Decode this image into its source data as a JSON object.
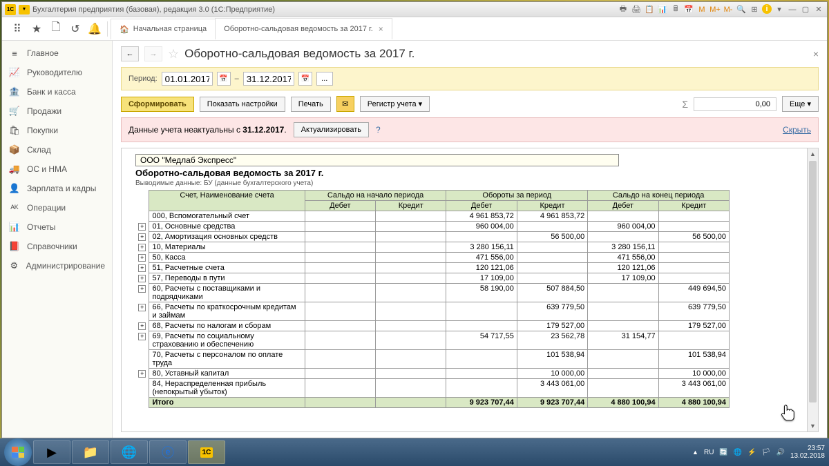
{
  "window_title": "Бухгалтерия предприятия (базовая), редакция 3.0  (1С:Предприятие)",
  "logo_text": "1С",
  "tabs": {
    "home": "Начальная страница",
    "report": "Оборотно-сальдовая ведомость за 2017 г."
  },
  "sidebar": [
    {
      "icon": "≡",
      "label": "Главное"
    },
    {
      "icon": "📈",
      "label": "Руководителю"
    },
    {
      "icon": "🏦",
      "label": "Банк и касса"
    },
    {
      "icon": "🛒",
      "label": "Продажи"
    },
    {
      "icon": "🛍",
      "label": "Покупки"
    },
    {
      "icon": "📦",
      "label": "Склад"
    },
    {
      "icon": "🚚",
      "label": "ОС и НМА"
    },
    {
      "icon": "👤",
      "label": "Зарплата и кадры"
    },
    {
      "icon": "ᴬᴷ",
      "label": "Операции"
    },
    {
      "icon": "📊",
      "label": "Отчеты"
    },
    {
      "icon": "📕",
      "label": "Справочники"
    },
    {
      "icon": "⚙",
      "label": "Администрирование"
    }
  ],
  "page": {
    "title": "Оборотно-сальдовая ведомость за 2017 г.",
    "period_label": "Период:",
    "date_from": "01.01.2017",
    "date_to": "31.12.2017",
    "form_btn": "Сформировать",
    "settings_btn": "Показать настройки",
    "print_btn": "Печать",
    "register_btn": "Регистр учета",
    "more_btn": "Еще",
    "sum_value": "0,00",
    "alert_text_a": "Данные учета неактуальны с ",
    "alert_date": "31.12.2017",
    "alert_btn": "Актуализировать",
    "alert_hide": "Скрыть"
  },
  "report": {
    "org": "ООО \"Медлаб Экспресс\"",
    "title": "Оборотно-сальдовая ведомость за 2017 г.",
    "subtitle": "Выводимые данные:  БУ (данные бухгалтерского учета)",
    "headers": {
      "acct": "Счет, Наименование счета",
      "g1": "Сальдо на начало периода",
      "g2": "Обороты за период",
      "g3": "Сальдо на конец периода",
      "debit": "Дебет",
      "credit": "Кредит"
    },
    "rows": [
      {
        "exp": false,
        "acct": "000, Вспомогательный счет",
        "d1": "",
        "c1": "",
        "d2": "4 961 853,72",
        "c2": "4 961 853,72",
        "d3": "",
        "c3": ""
      },
      {
        "exp": true,
        "acct": "01, Основные средства",
        "d1": "",
        "c1": "",
        "d2": "960 004,00",
        "c2": "",
        "d3": "960 004,00",
        "c3": ""
      },
      {
        "exp": true,
        "acct": "02, Амортизация основных средств",
        "d1": "",
        "c1": "",
        "d2": "",
        "c2": "56 500,00",
        "d3": "",
        "c3": "56 500,00"
      },
      {
        "exp": true,
        "acct": "10, Материалы",
        "d1": "",
        "c1": "",
        "d2": "3 280 156,11",
        "c2": "",
        "d3": "3 280 156,11",
        "c3": ""
      },
      {
        "exp": true,
        "acct": "50, Касса",
        "d1": "",
        "c1": "",
        "d2": "471 556,00",
        "c2": "",
        "d3": "471 556,00",
        "c3": ""
      },
      {
        "exp": true,
        "acct": "51, Расчетные счета",
        "d1": "",
        "c1": "",
        "d2": "120 121,06",
        "c2": "",
        "d3": "120 121,06",
        "c3": ""
      },
      {
        "exp": true,
        "acct": "57, Переводы в пути",
        "d1": "",
        "c1": "",
        "d2": "17 109,00",
        "c2": "",
        "d3": "17 109,00",
        "c3": ""
      },
      {
        "exp": true,
        "acct": "60, Расчеты с поставщиками и подрядчиками",
        "d1": "",
        "c1": "",
        "d2": "58 190,00",
        "c2": "507 884,50",
        "d3": "",
        "c3": "449 694,50"
      },
      {
        "exp": true,
        "acct": "66, Расчеты по краткосрочным кредитам и займам",
        "d1": "",
        "c1": "",
        "d2": "",
        "c2": "639 779,50",
        "d3": "",
        "c3": "639 779,50"
      },
      {
        "exp": true,
        "acct": "68, Расчеты по налогам и сборам",
        "d1": "",
        "c1": "",
        "d2": "",
        "c2": "179 527,00",
        "d3": "",
        "c3": "179 527,00"
      },
      {
        "exp": true,
        "acct": "69, Расчеты по социальному страхованию и обеспечению",
        "d1": "",
        "c1": "",
        "d2": "54 717,55",
        "c2": "23 562,78",
        "d3": "31 154,77",
        "c3": ""
      },
      {
        "exp": false,
        "acct": "70, Расчеты с персоналом по оплате труда",
        "d1": "",
        "c1": "",
        "d2": "",
        "c2": "101 538,94",
        "d3": "",
        "c3": "101 538,94"
      },
      {
        "exp": true,
        "acct": "80, Уставный капитал",
        "d1": "",
        "c1": "",
        "d2": "",
        "c2": "10 000,00",
        "d3": "",
        "c3": "10 000,00"
      },
      {
        "exp": false,
        "acct": "84, Нераспределенная прибыль (непокрытый убыток)",
        "d1": "",
        "c1": "",
        "d2": "",
        "c2": "3 443 061,00",
        "d3": "",
        "c3": "3 443 061,00"
      }
    ],
    "totals": {
      "label": "Итого",
      "d1": "",
      "c1": "",
      "d2": "9 923 707,44",
      "c2": "9 923 707,44",
      "d3": "4 880 100,94",
      "c3": "4 880 100,94"
    }
  },
  "tray": {
    "lang": "RU",
    "time": "23:57",
    "date": "13.02.2018"
  }
}
